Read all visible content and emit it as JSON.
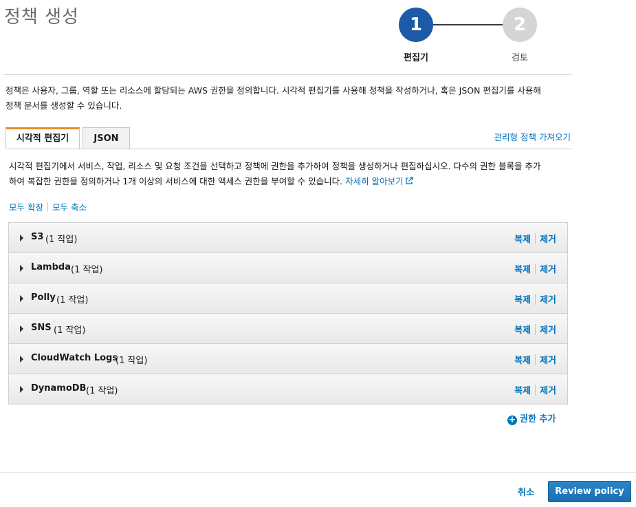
{
  "page": {
    "title": "정책 생성"
  },
  "stepper": {
    "steps": [
      {
        "number": "1",
        "label": "편집기",
        "state": "active"
      },
      {
        "number": "2",
        "label": "검토",
        "state": "inactive"
      }
    ]
  },
  "description": {
    "line1": "정책은 사용자, 그룹, 역할 또는 리소스에 할당되는 AWS 권한을 정의합니다. 시각적 편집기를 사용해 정책을 작성하거나, 혹은 JSON 편집기를 사용해",
    "line2": "정책 문서를 생성할 수 있습니다."
  },
  "tabs": [
    {
      "label": "시각적 편집기",
      "active": true
    },
    {
      "label": "JSON",
      "active": false
    }
  ],
  "import_link": "관리형 정책 가져오기",
  "editor": {
    "desc_line1": "시각적 편집기에서 서비스, 작업, 리소스 및 요청 조건을 선택하고 정책에 권한을 추가하여 정책을 생성하거나 편집하십시오. 다수의 권한 블록을 추가",
    "desc_line2": "하여 복잡한 권한을 정의하거나 1개 이상의 서비스에 대한 액세스 권한을 부여할 수 있습니다.",
    "learn_more": "자세히 알아보기",
    "expand_all": "모두 확장",
    "collapse_all": "모두 축소"
  },
  "services": [
    {
      "name": "S3",
      "count": "(1 작업)"
    },
    {
      "name": "Lambda",
      "count": "(1 작업)"
    },
    {
      "name": "Polly",
      "count": "(1 작업)"
    },
    {
      "name": "SNS",
      "count": "(1 작업)"
    },
    {
      "name": "CloudWatch Logs",
      "count": "(1 작업)"
    },
    {
      "name": "DynamoDB",
      "count": "(1 작업)"
    }
  ],
  "row_actions": {
    "duplicate": "복제",
    "remove": "제거"
  },
  "add_permission": "권한 추가",
  "footer": {
    "cancel": "취소",
    "review": "Review policy"
  },
  "colors": {
    "accent_blue": "#0073bb",
    "step_active": "#1d5aa8",
    "step_inactive": "#d5d5d5",
    "tab_active_border": "#e88b28",
    "primary_button": "#1a6fb3"
  }
}
